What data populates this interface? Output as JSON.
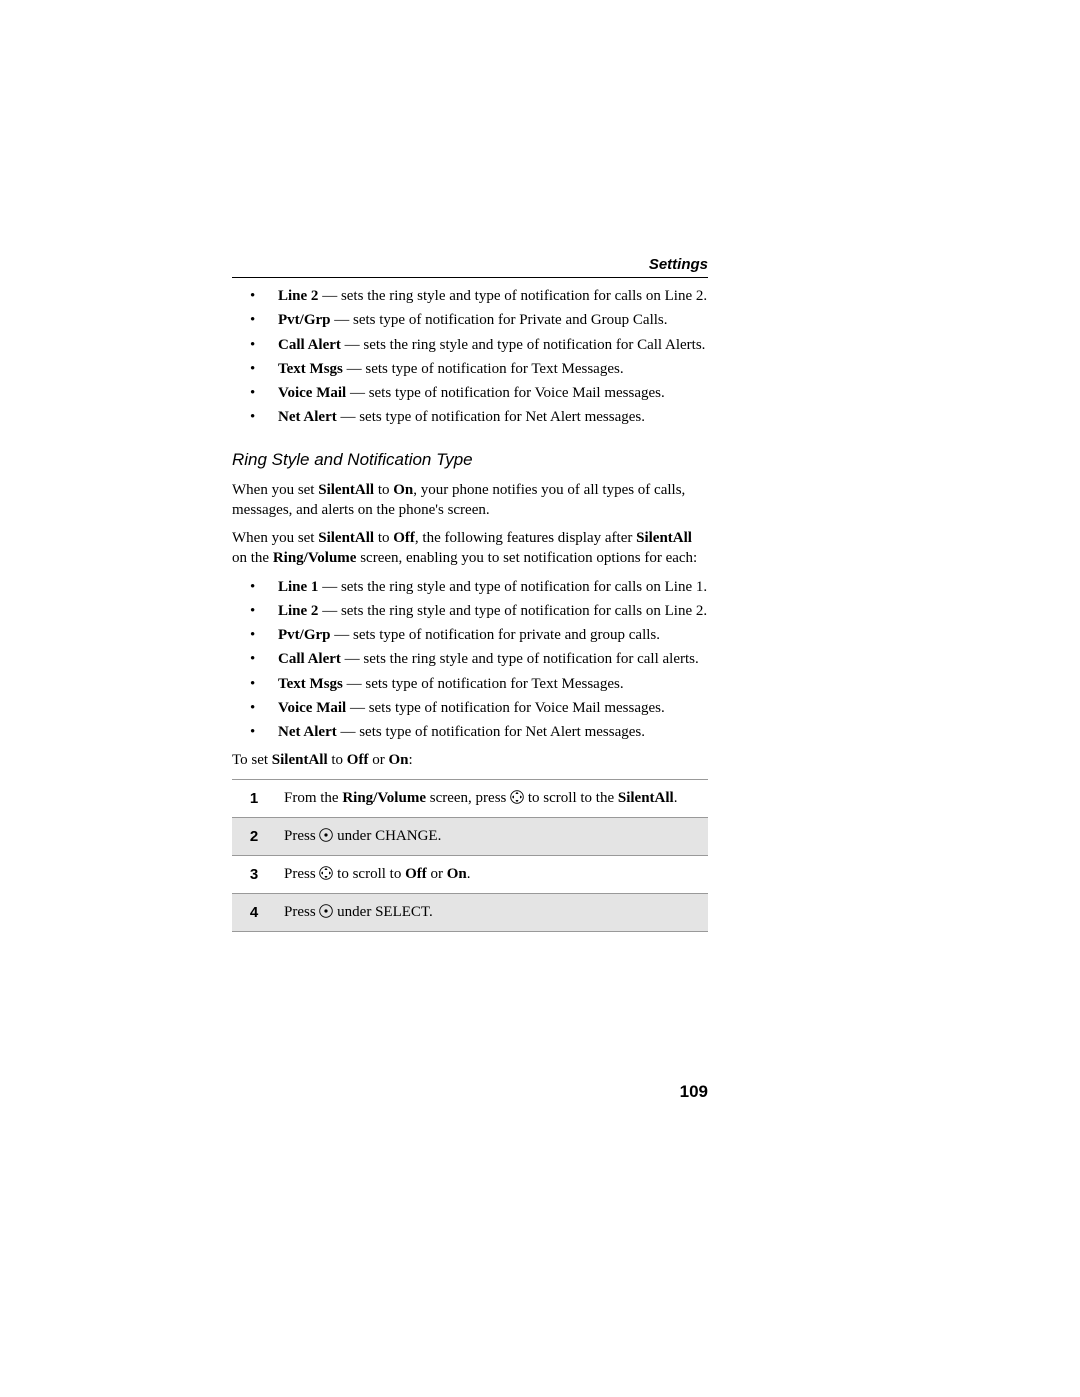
{
  "header": {
    "title": "Settings"
  },
  "list1": [
    {
      "term": "Line 2",
      "desc": " — sets the ring style and type of notification for calls on Line 2."
    },
    {
      "term": "Pvt/Grp",
      "desc": " — sets type of notification for Private and Group Calls."
    },
    {
      "term": "Call Alert",
      "desc": " — sets the ring style and type of notification for Call Alerts."
    },
    {
      "term": "Text Msgs",
      "desc": " — sets type of notification for Text Messages."
    },
    {
      "term": "Voice Mail",
      "desc": " — sets type of notification for Voice Mail messages."
    },
    {
      "term": "Net Alert",
      "desc": " — sets type of notification for Net Alert messages."
    }
  ],
  "section_heading": "Ring Style and Notification Type",
  "para1": {
    "pre": "When you set ",
    "b1": "SilentAll",
    "mid1": " to ",
    "b2": "On",
    "post": ", your phone notifies you of all types of calls, messages, and alerts on the phone's screen."
  },
  "para2": {
    "pre": "When you set ",
    "b1": "SilentAll",
    "mid1": " to ",
    "b2": "Off",
    "mid2": ", the following features display after ",
    "b3": "SilentAll",
    "mid3": " on the ",
    "b4": "Ring/Volume",
    "post": " screen, enabling you to set notification options for each:"
  },
  "list2": [
    {
      "term": "Line 1",
      "desc": " — sets the ring style and type of notification for calls on Line 1."
    },
    {
      "term": "Line 2",
      "desc": " — sets the ring style and type of notification for calls on Line 2."
    },
    {
      "term": "Pvt/Grp",
      "desc": " — sets type of notification for private and group calls."
    },
    {
      "term": "Call Alert",
      "desc": " — sets the ring style and type of notification for call alerts."
    },
    {
      "term": "Text Msgs",
      "desc": " — sets type of notification for Text Messages."
    },
    {
      "term": "Voice Mail",
      "desc": " — sets type of notification for Voice Mail messages."
    },
    {
      "term": "Net Alert",
      "desc": " — sets type of notification for Net Alert messages."
    }
  ],
  "para3": {
    "pre": "To set ",
    "b1": "SilentAll",
    "mid1": " to ",
    "b2": "Off",
    "mid2": " or ",
    "b3": "On",
    "post": ":"
  },
  "steps": [
    {
      "num": "1",
      "parts": {
        "pre": "From the ",
        "b1": "Ring/Volume",
        "mid1": " screen, press ",
        "icon": "nav",
        "mid2": " to scroll to the ",
        "b2": "SilentAll",
        "post": "."
      }
    },
    {
      "num": "2",
      "parts": {
        "pre": "Press ",
        "icon": "dot",
        "post": " under CHANGE."
      }
    },
    {
      "num": "3",
      "parts": {
        "pre": "Press ",
        "icon": "nav",
        "mid1": " to scroll to ",
        "b1": "Off",
        "mid2": " or ",
        "b2": "On",
        "post": "."
      }
    },
    {
      "num": "4",
      "parts": {
        "pre": "Press ",
        "icon": "dot",
        "post": " under SELECT."
      }
    }
  ],
  "page_number": "109"
}
